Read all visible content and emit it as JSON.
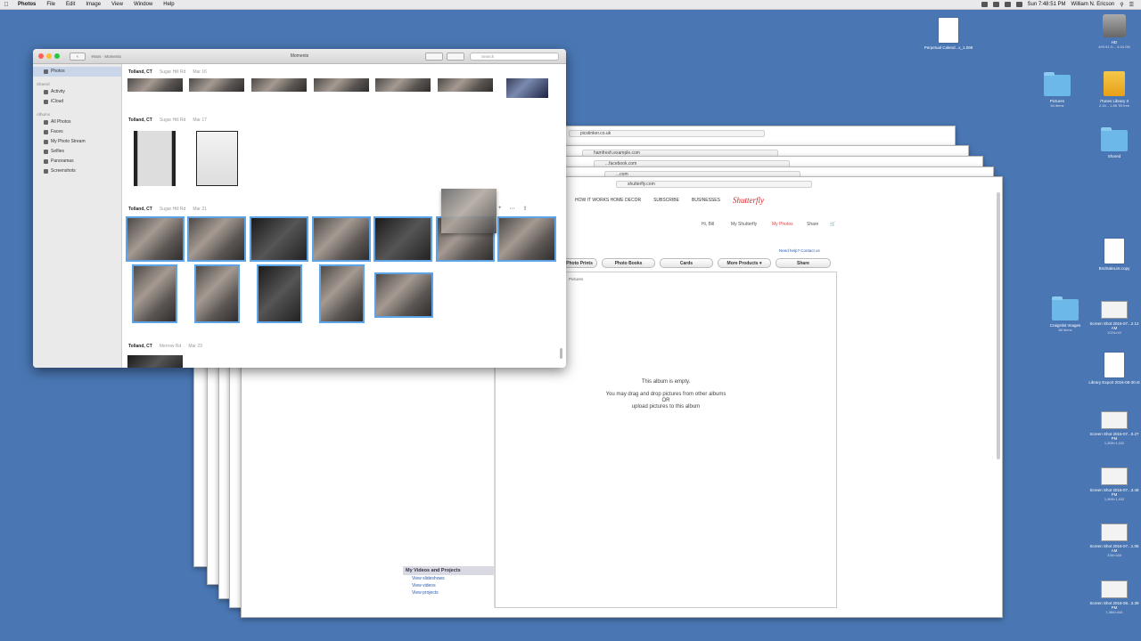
{
  "menubar": {
    "app": "Photos",
    "items": [
      "File",
      "Edit",
      "Image",
      "View",
      "Window",
      "Help"
    ],
    "clock": "Sun 7:48:51 PM",
    "user": "William N. Ericson"
  },
  "desktop_icons": [
    {
      "name": "Perpetual Calend...x_1.098",
      "sub": ""
    },
    {
      "name": "HD",
      "sub": "499.91 G... 4.04 GB"
    },
    {
      "name": "Pictures",
      "sub": "64 items"
    },
    {
      "name": "iTunes Library 3",
      "sub": "2.16... 1.86 TB free"
    },
    {
      "name": "Shared",
      "sub": ""
    },
    {
      "name": "BirdSaleList.copy",
      "sub": ""
    },
    {
      "name": "Craigslist Images",
      "sub": "68 items"
    },
    {
      "name": "Screen Shot 2016-07...2.12 AM",
      "sub": "1024×40"
    },
    {
      "name": "Library Export 2016-08-30.nt",
      "sub": ""
    },
    {
      "name": "Screen Shot 2016-07...0.27 PM",
      "sub": "1,368×1,432"
    },
    {
      "name": "Screen Shot 2016-07...3.48 PM",
      "sub": "1,368×1,432"
    },
    {
      "name": "Screen Shot 2016-07...1.05 AM",
      "sub": "336×168"
    },
    {
      "name": "Screen Shot 2016-08...3.39 PM",
      "sub": "1,368×444"
    }
  ],
  "browsers": {
    "urls": [
      "picstinker.co.uk",
      "hamfresh.example.com",
      "...facebook.com",
      "...com",
      "shutterfly.com"
    ],
    "nav": [
      "HOW IT WORKS HOME DECOR",
      "SUBSCRIBE",
      "BUSINESSES",
      "Shutterfly"
    ],
    "account": {
      "greeting": "Hi, Bill",
      "my": "My Shutterfly",
      "photos": "My Photos",
      "share": "Share",
      "cart": "Cart"
    },
    "help": "Need help? Contact us",
    "toolbar": [
      "Photo Prints",
      "Photo Books",
      "Cards",
      "More Products ▾",
      "Share"
    ],
    "album_label": "Pictures",
    "empty_line1": "This album is empty.",
    "empty_line2": "You may drag and drop pictures from other albums",
    "empty_line3": "OR",
    "empty_line4": "upload pictures to this album",
    "projects_head": "My Videos and Projects",
    "projects_links": [
      "View slideshows",
      "View videos",
      "View projects"
    ]
  },
  "photos_window": {
    "title": "Moments",
    "back": "‹",
    "mode": "Years · Moments",
    "search_placeholder": "Search",
    "sidebar": {
      "selected": "Photos",
      "shared_header": "Shared",
      "shared_items": [
        "Activity",
        "iCloud"
      ],
      "albums_header": "Albums",
      "albums_items": [
        "All Photos",
        "Faces",
        "My Photo Stream",
        "Selfies",
        "Panoramas",
        "Screenshots"
      ]
    },
    "moments": [
      {
        "loc": "Tolland, CT",
        "street": "Sugar Hill Rd",
        "date": "Mar 16"
      },
      {
        "loc": "Tolland, CT",
        "street": "Sugar Hill Rd",
        "date": "Mar 17"
      },
      {
        "loc": "Tolland, CT",
        "street": "Sugar Hill Rd",
        "date": "Mar 21"
      },
      {
        "loc": "Tolland, CT",
        "street": "Merrow Rd",
        "date": "Mar 23"
      }
    ]
  },
  "colors": {
    "desktop": "#4a77b4",
    "selection": "#5ea3e6",
    "brand": "#d22222"
  }
}
